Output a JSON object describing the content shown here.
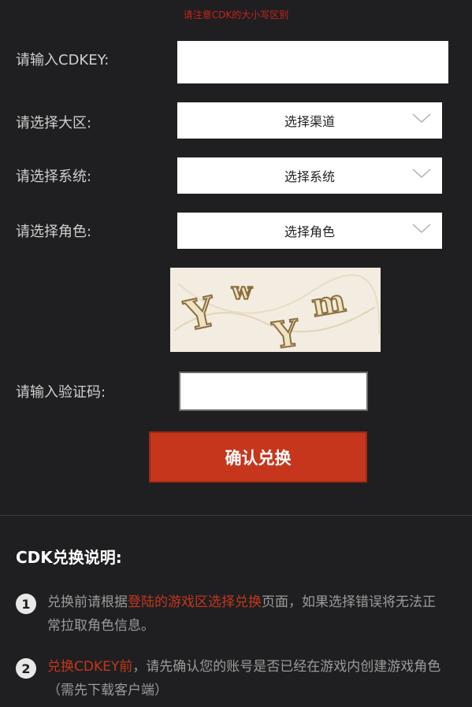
{
  "notice": "请注意CDK的大小写区别",
  "form": {
    "cdkey_label": "请输入CDKEY:",
    "region_label": "请选择大区:",
    "region_value": "选择渠道",
    "system_label": "请选择系统:",
    "system_value": "选择系统",
    "role_label": "请选择角色:",
    "role_value": "选择角色",
    "verify_label": "请输入验证码:",
    "confirm_label": "确认兑换"
  },
  "captcha": {
    "text": "YwYm"
  },
  "info": {
    "title": "CDK兑换说明:",
    "items": [
      {
        "num": "1",
        "pre": "兑换前请根据",
        "highlight": "登陆的游戏区选择兑换",
        "post": "页面，如果选择错误将无法正常拉取角色信息。"
      },
      {
        "num": "2",
        "pre": "",
        "highlight": "兑换CDKEY前",
        "post": "，请先确认您的账号是否已经在游戏内创建游戏角色（需先下载客户端）"
      }
    ]
  },
  "colors": {
    "background": "#1f1f21",
    "accent": "#c5361c",
    "notice": "#c8221a"
  }
}
